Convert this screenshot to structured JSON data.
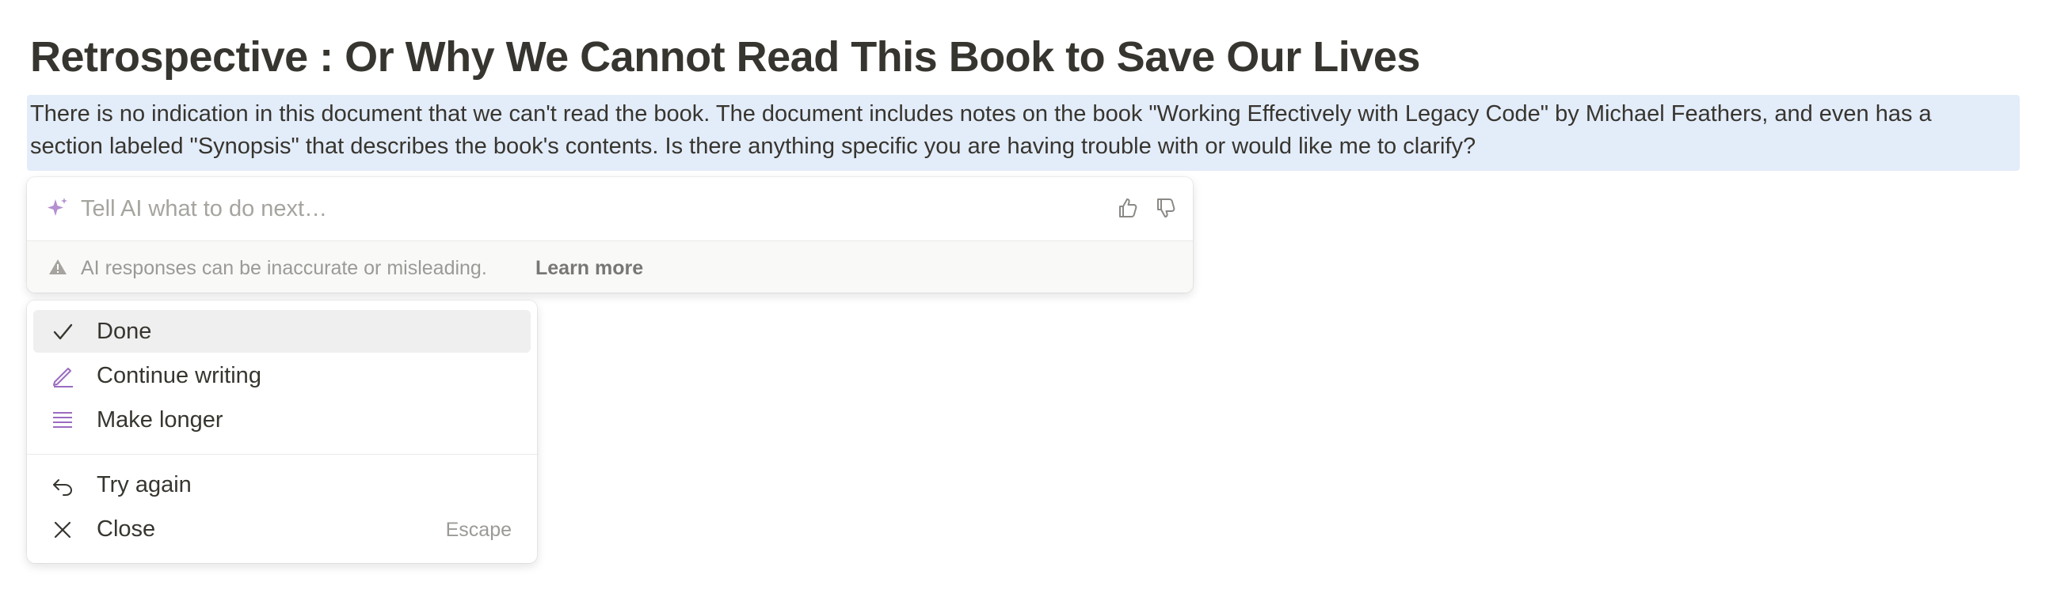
{
  "page": {
    "title": "Retrospective : Or Why We Cannot Read This Book to Save Our Lives",
    "highlighted_text": "There is no indication in this document that we can't read the book. The document includes notes on the book \"Working Effectively with Legacy Code\" by Michael Feathers, and even has a section labeled \"Synopsis\" that describes the book's contents. Is there anything specific you are having trouble with or would like me to clarify?"
  },
  "ai_bar": {
    "icon": "sparkle-icon",
    "input_value": "",
    "placeholder": "Tell AI what to do next…",
    "feedback_icons": [
      "thumbs-up-icon",
      "thumbs-down-icon"
    ],
    "disclaimer": "AI responses can be inaccurate or misleading.",
    "learn_more": "Learn more"
  },
  "menu": {
    "items": [
      {
        "label": "Done",
        "icon": "checkmark-icon",
        "selected": true
      },
      {
        "label": "Continue writing",
        "icon": "pen-icon"
      },
      {
        "label": "Make longer",
        "icon": "lines-icon"
      },
      {
        "label": "Try again",
        "icon": "undo-icon"
      },
      {
        "label": "Close",
        "icon": "close-icon",
        "shortcut": "Escape"
      }
    ]
  },
  "colors": {
    "text": "#37352f",
    "highlight": "#e3ecf9",
    "ai_accent": "#9b6bc0",
    "muted": "#9b9a97"
  }
}
